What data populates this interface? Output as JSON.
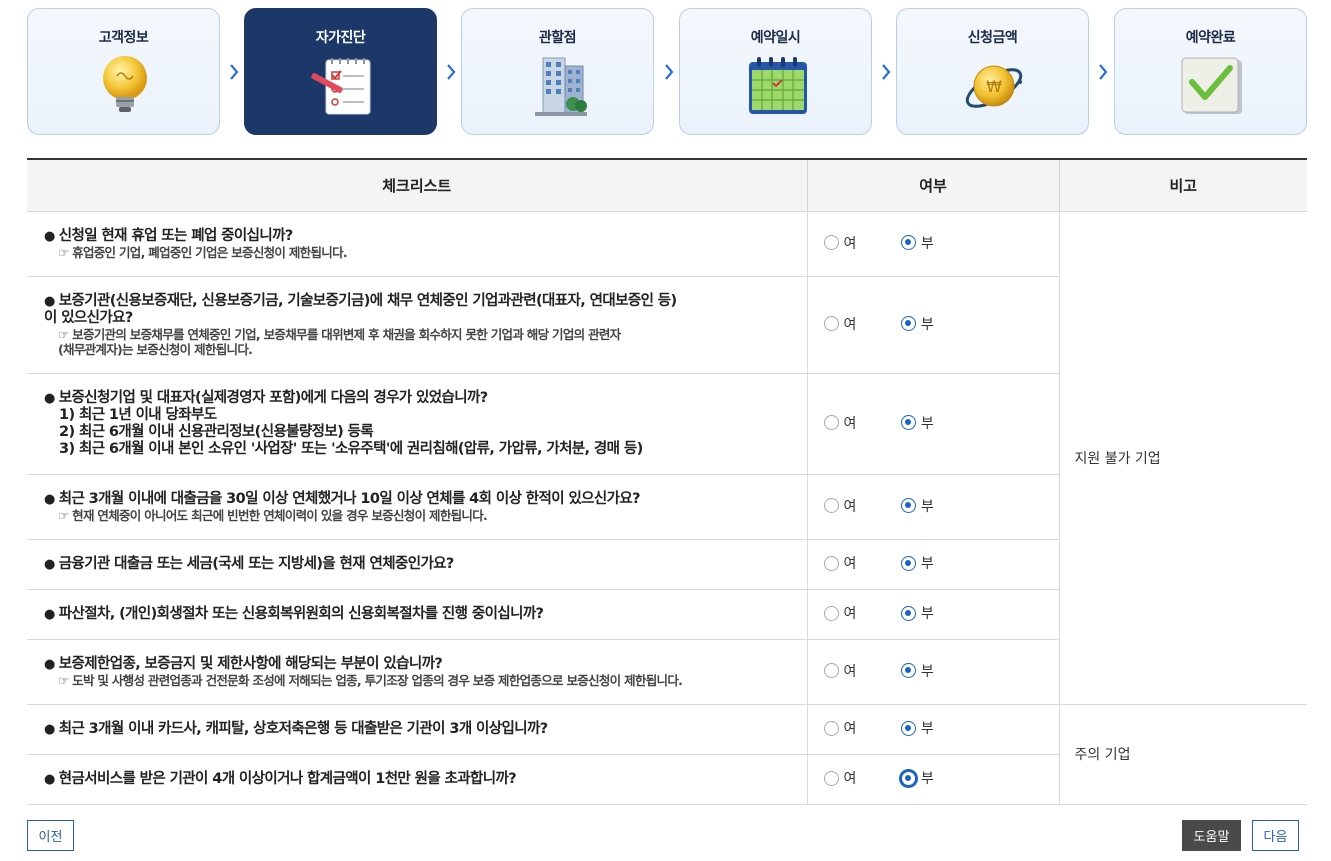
{
  "steps": [
    {
      "label": "고객정보",
      "icon": "lightbulb-icon",
      "active": false
    },
    {
      "label": "자가진단",
      "icon": "checklist-icon",
      "active": true
    },
    {
      "label": "관할점",
      "icon": "building-icon",
      "active": false
    },
    {
      "label": "예약일시",
      "icon": "calendar-icon",
      "active": false
    },
    {
      "label": "신청금액",
      "icon": "coin-icon",
      "active": false
    },
    {
      "label": "예약완료",
      "icon": "checkmark-icon",
      "active": false
    }
  ],
  "table": {
    "headers": {
      "question": "체크리스트",
      "answer": "여부",
      "note": "비고"
    },
    "options": {
      "yes": "여",
      "no": "부"
    },
    "notes": {
      "group1": "지원 불가 기업",
      "group2": "주의 기업"
    },
    "rows": [
      {
        "q": "신청일 현재 휴업 또는 폐업 중이십니까?",
        "sub": [
          "☞ 휴업중인 기업, 폐업중인 기업은 보증신청이 제한됩니다."
        ],
        "lines": []
      },
      {
        "q": "보증기관(신용보증재단, 신용보증기금, 기술보증기금)에 채무 연체중인 기업과관련(대표자, 연대보증인 등)",
        "q2": "이 있으신가요?",
        "sub": [
          "☞ 보증기관의 보증채무를 연체중인 기업, 보증채무를 대위변제 후 채권을 회수하지 못한 기업과 해당 기업의 관련자",
          "(채무관계자)는 보증신청이 제한됩니다."
        ],
        "lines": []
      },
      {
        "q": "보증신청기업 및 대표자(실제경영자 포함)에게 다음의 경우가 있었습니까?",
        "sub": [],
        "lines": [
          "1) 최근 1년 이내 당좌부도",
          "2) 최근 6개월 이내 신용관리정보(신용불량정보) 등록",
          "3) 최근 6개월 이내 본인 소유인 '사업장' 또는 '소유주택'에 권리침해(압류, 가압류, 가처분, 경매 등)"
        ]
      },
      {
        "q": "최근 3개월 이내에 대출금을 30일 이상 연체했거나 10일 이상 연체를 4회 이상 한적이 있으신가요?",
        "sub": [
          "☞ 현재 연체중이 아니어도 최근에 빈번한 연체이력이 있을 경우 보증신청이 제한됩니다."
        ],
        "lines": []
      },
      {
        "q": "금융기관 대출금 또는 세금(국세 또는 지방세)을 현재 연체중인가요?",
        "sub": [],
        "lines": []
      },
      {
        "q": "파산절차, (개인)회생절차 또는 신용회복위원회의 신용회복절차를 진행 중이십니까?",
        "sub": [],
        "lines": []
      },
      {
        "q": "보증제한업종, 보증금지 및 제한사항에 해당되는 부분이 있습니까?",
        "sub": [
          "☞ 도박 및 사행성 관련업종과 건전문화 조성에 저해되는 업종, 투기조장 업종의 경우 보증 제한업종으로 보증신청이 제한됩니다."
        ],
        "lines": []
      },
      {
        "q": "최근 3개월 이내 카드사, 캐피탈, 상호저축은행 등 대출받은 기관이 3개 이상입니까?",
        "sub": [],
        "lines": []
      },
      {
        "q": "현금서비스를 받은 기관이 4개 이상이거나 합계금액이 1천만 원을 초과합니까?",
        "sub": [],
        "lines": []
      }
    ]
  },
  "buttons": {
    "prev": "이전",
    "help": "도움말",
    "next": "다음"
  },
  "colors": {
    "active_step": "#1b3868",
    "radio_selected": "#1b62c4",
    "header_border": "#333333"
  }
}
